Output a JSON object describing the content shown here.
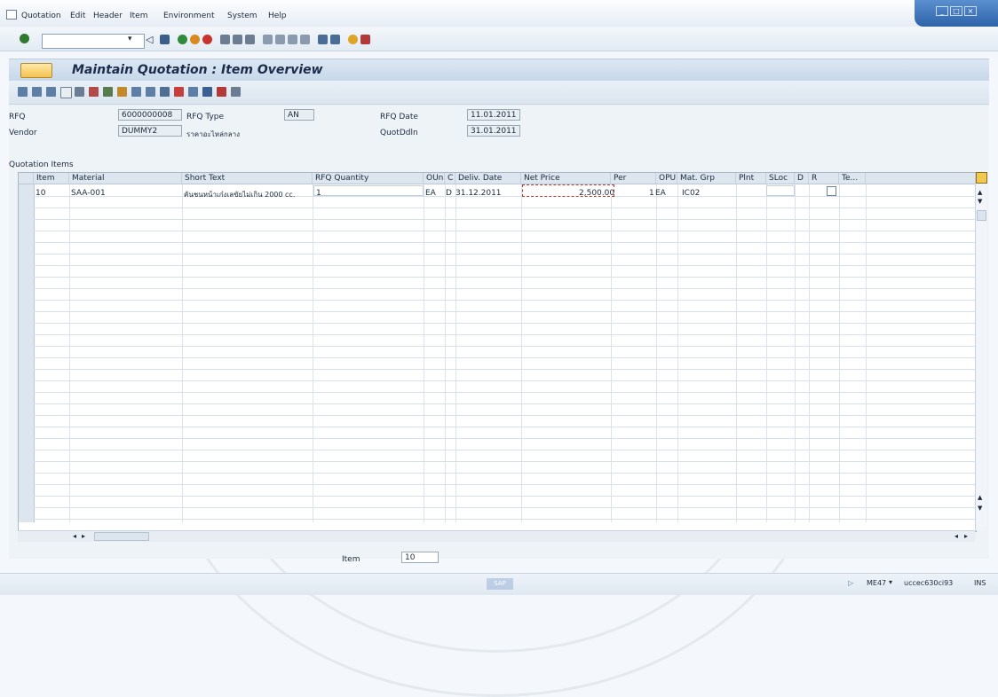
{
  "menu": {
    "items": [
      "Quotation",
      "Edit",
      "Header",
      "Item",
      "Environment",
      "System",
      "Help"
    ]
  },
  "window_controls": [
    "_",
    "□",
    "×"
  ],
  "system_toolbar": {
    "command_field": "",
    "icons": [
      "enter-icon",
      "save-icon",
      "back-icon",
      "exit-icon",
      "cancel-icon",
      "print-icon",
      "find-icon",
      "find-next-icon",
      "first-page-icon",
      "prev-page-icon",
      "next-page-icon",
      "last-page-icon",
      "new-session-icon",
      "shortcut-icon",
      "help-icon",
      "layout-icon"
    ]
  },
  "title": "Maintain Quotation : Item Overview",
  "header": {
    "rfq_label": "RFQ",
    "rfq_value": "6000000008",
    "rfq_type_label": "RFQ Type",
    "rfq_type_value": "AN",
    "rfq_date_label": "RFQ Date",
    "rfq_date_value": "11.01.2011",
    "vendor_label": "Vendor",
    "vendor_value": "DUMMY2",
    "vendor_name": "ราคาอะไหล่กลาง",
    "quotddln_label": "QuotDdln",
    "quotddln_value": "31.01.2011"
  },
  "section_title": "Quotation Items",
  "table": {
    "columns": [
      "Item",
      "Material",
      "Short Text",
      "RFQ Quantity",
      "OUn",
      "C",
      "Deliv. Date",
      "Net Price",
      "Per",
      "OPU",
      "Mat. Grp",
      "Plnt",
      "SLoc",
      "D",
      "R",
      "Te..."
    ],
    "rows": [
      {
        "item": "10",
        "material": "SAA-001",
        "short_text": "คันชนหน้าเก๋งเลขัยไม่เกิน 2000 cc.",
        "rfq_quantity": "1",
        "oun": "EA",
        "c": "D",
        "deliv_date": "31.12.2011",
        "net_price": "2,500.00",
        "per": "1",
        "opu": "EA",
        "mat_grp": "IC02"
      }
    ]
  },
  "footer": {
    "item_label": "Item",
    "item_value": "10"
  },
  "status": {
    "transaction": "ME47",
    "server": "uccec630ci93",
    "mode": "INS"
  }
}
